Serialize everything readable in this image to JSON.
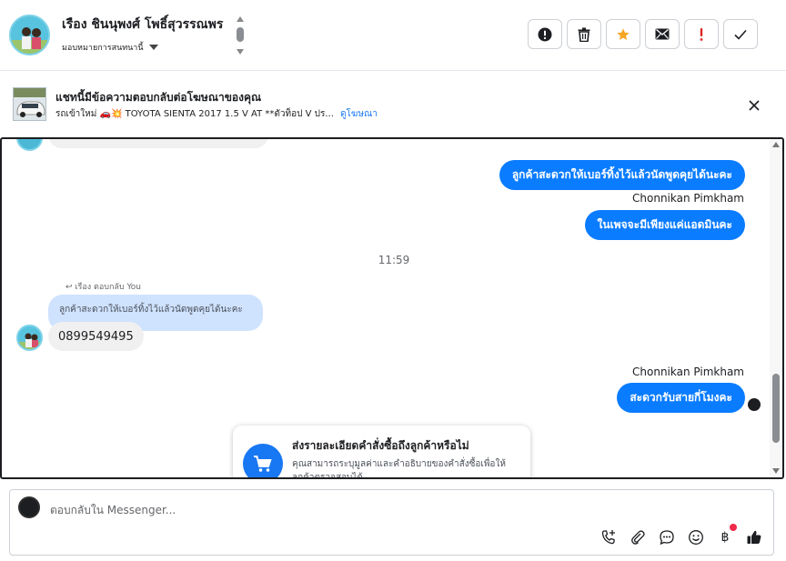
{
  "header": {
    "contact_name": "เรือง ชินนุพงศ์ โพธิ์สุวรรณพร",
    "assign_label": "มอบหมายการสนทนานี้",
    "toolbar": [
      {
        "name": "spam-alert-button",
        "icon": "exclamation-circle-icon"
      },
      {
        "name": "delete-button",
        "icon": "trash-icon"
      },
      {
        "name": "star-button",
        "icon": "star-icon"
      },
      {
        "name": "mark-unread-button",
        "icon": "envelope-icon"
      },
      {
        "name": "follow-up-button",
        "icon": "exclamation-icon"
      },
      {
        "name": "mark-done-button",
        "icon": "checkmark-icon"
      }
    ],
    "colors": {
      "star": "#f5a623",
      "follow_up": "#e02424"
    }
  },
  "ad_banner": {
    "title": "แชทนี้มีข้อความตอบกลับต่อโฆษณาของคุณ",
    "description": "รถเข้าใหม่ 🚗💥 TOYOTA SIENTA 2017 1.5 V AT **ตัวท็อป V ปร...",
    "link_label": "ดูโฆษณา"
  },
  "messages": {
    "out_1": "ลูกค้าสะดวกให้เบอร์ทิ้งไว้แล้วนัดพูดคุยได้นะคะ",
    "sender_1": "Chonnikan Pimkham",
    "out_2": "ในเพจจะมีเพียงแค่แอดมินคะ",
    "timestamp": "11:59",
    "reply_hint": "เรือง ตอบกลับ You",
    "reply_quote": "ลูกค้าสะดวกให้เบอร์ทิ้งไว้แล้วนัดพูดคุยได้นะคะ",
    "in_1": "0899549495",
    "sender_2": "Chonnikan Pimkham",
    "out_3": "สะดวกรับสายกี่โมงคะ"
  },
  "suggestion_card": {
    "title": "ส่งรายละเอียดคำสั่งซื้อถึงลูกค้าหรือไม่",
    "body": "คุณสามารถระบุมูลค่าและคำอธิบายของคำสั่งซื้อเพื่อให้ลูกค้าตรวจสอบได้"
  },
  "composer": {
    "placeholder": "ตอบกลับใน Messenger...",
    "tools": [
      "call-add-icon",
      "paperclip-icon",
      "saved-reply-icon",
      "emoji-icon",
      "baht-icon",
      "thumbs-up-icon"
    ],
    "currency_symbol": "฿"
  }
}
